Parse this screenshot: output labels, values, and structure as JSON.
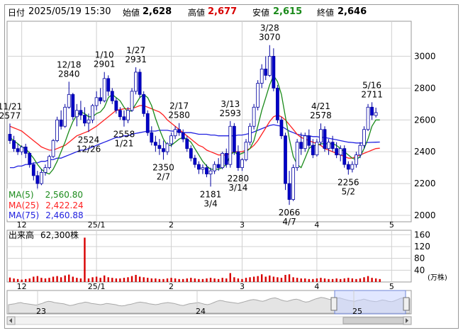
{
  "header": {
    "label_date": "日付",
    "datetime": "2025/05/19 15:30",
    "label_open": "始値",
    "open": "2,628",
    "label_high": "高値",
    "high": "2,677",
    "label_low": "安値",
    "low": "2,615",
    "label_close": "終値",
    "close": "2,646"
  },
  "colors": {
    "accent_red": "#d80000",
    "ma5": "#1a8a1a",
    "ma25": "#ff2020",
    "ma75": "#2020e0",
    "up_candle": "#ffffff",
    "down_candle": "#0000c8",
    "grid": "#d0d0d0",
    "volume": "#d80000",
    "navigator": "#a8a8a8"
  },
  "legend": {
    "ma5_label": "MA(5)",
    "ma5_value": "2,560.80",
    "ma25_label": "MA(25)",
    "ma25_value": "2,422.24",
    "ma75_label": "MA(75)",
    "ma75_value": "2,460.88"
  },
  "volume_label": "出来高",
  "volume_value": "62,300株",
  "volume_unit": "(万株)",
  "volume_ticks": [
    "160",
    "120",
    "80",
    "40"
  ],
  "nav_labels": [
    "23",
    "24",
    "25"
  ],
  "chart_data": {
    "type": "candlestick",
    "y_ticks": [
      3000,
      2800,
      2600,
      2400,
      2200,
      2000
    ],
    "ylim": [
      1960,
      3220
    ],
    "x_ticks": [
      {
        "label": "12",
        "index": 3
      },
      {
        "label": "25/1",
        "index": 22
      },
      {
        "label": "2",
        "index": 41
      },
      {
        "label": "3",
        "index": 59
      },
      {
        "label": "4",
        "index": 78
      },
      {
        "label": "5",
        "index": 97
      }
    ],
    "candles": [
      {
        "o": 2510,
        "h": 2577,
        "l": 2450,
        "c": 2470
      },
      {
        "o": 2470,
        "h": 2500,
        "l": 2400,
        "c": 2420
      },
      {
        "o": 2420,
        "h": 2450,
        "l": 2380,
        "c": 2400
      },
      {
        "o": 2400,
        "h": 2440,
        "l": 2380,
        "c": 2430
      },
      {
        "o": 2430,
        "h": 2450,
        "l": 2360,
        "c": 2390
      },
      {
        "o": 2390,
        "h": 2400,
        "l": 2300,
        "c": 2320
      },
      {
        "o": 2320,
        "h": 2330,
        "l": 2220,
        "c": 2250
      },
      {
        "o": 2250,
        "h": 2280,
        "l": 2160,
        "c": 2200
      },
      {
        "o": 2200,
        "h": 2290,
        "l": 2190,
        "c": 2270
      },
      {
        "o": 2270,
        "h": 2320,
        "l": 2250,
        "c": 2300
      },
      {
        "o": 2300,
        "h": 2380,
        "l": 2290,
        "c": 2370
      },
      {
        "o": 2370,
        "h": 2480,
        "l": 2360,
        "c": 2470
      },
      {
        "o": 2470,
        "h": 2620,
        "l": 2460,
        "c": 2600
      },
      {
        "o": 2600,
        "h": 2660,
        "l": 2540,
        "c": 2560
      },
      {
        "o": 2560,
        "h": 2700,
        "l": 2550,
        "c": 2680
      },
      {
        "o": 2680,
        "h": 2840,
        "l": 2670,
        "c": 2760
      },
      {
        "o": 2760,
        "h": 2770,
        "l": 2600,
        "c": 2620
      },
      {
        "o": 2620,
        "h": 2700,
        "l": 2560,
        "c": 2660
      },
      {
        "o": 2660,
        "h": 2720,
        "l": 2600,
        "c": 2630
      },
      {
        "o": 2630,
        "h": 2680,
        "l": 2560,
        "c": 2580
      },
      {
        "o": 2580,
        "h": 2640,
        "l": 2524,
        "c": 2600
      },
      {
        "o": 2600,
        "h": 2700,
        "l": 2580,
        "c": 2690
      },
      {
        "o": 2690,
        "h": 2780,
        "l": 2660,
        "c": 2740
      },
      {
        "o": 2740,
        "h": 2800,
        "l": 2700,
        "c": 2720
      },
      {
        "o": 2720,
        "h": 2901,
        "l": 2710,
        "c": 2860
      },
      {
        "o": 2860,
        "h": 2880,
        "l": 2750,
        "c": 2780
      },
      {
        "o": 2780,
        "h": 2800,
        "l": 2700,
        "c": 2720
      },
      {
        "o": 2720,
        "h": 2740,
        "l": 2640,
        "c": 2660
      },
      {
        "o": 2660,
        "h": 2680,
        "l": 2600,
        "c": 2620
      },
      {
        "o": 2620,
        "h": 2660,
        "l": 2558,
        "c": 2600
      },
      {
        "o": 2600,
        "h": 2680,
        "l": 2580,
        "c": 2660
      },
      {
        "o": 2660,
        "h": 2800,
        "l": 2650,
        "c": 2780
      },
      {
        "o": 2780,
        "h": 2931,
        "l": 2760,
        "c": 2900
      },
      {
        "o": 2900,
        "h": 2920,
        "l": 2740,
        "c": 2760
      },
      {
        "o": 2760,
        "h": 2780,
        "l": 2620,
        "c": 2640
      },
      {
        "o": 2640,
        "h": 2660,
        "l": 2500,
        "c": 2520
      },
      {
        "o": 2520,
        "h": 2560,
        "l": 2440,
        "c": 2460
      },
      {
        "o": 2460,
        "h": 2500,
        "l": 2400,
        "c": 2440
      },
      {
        "o": 2440,
        "h": 2480,
        "l": 2380,
        "c": 2420
      },
      {
        "o": 2420,
        "h": 2470,
        "l": 2350,
        "c": 2400
      },
      {
        "o": 2400,
        "h": 2460,
        "l": 2380,
        "c": 2450
      },
      {
        "o": 2450,
        "h": 2520,
        "l": 2430,
        "c": 2500
      },
      {
        "o": 2500,
        "h": 2560,
        "l": 2480,
        "c": 2540
      },
      {
        "o": 2540,
        "h": 2580,
        "l": 2500,
        "c": 2520
      },
      {
        "o": 2520,
        "h": 2540,
        "l": 2460,
        "c": 2480
      },
      {
        "o": 2480,
        "h": 2500,
        "l": 2400,
        "c": 2420
      },
      {
        "o": 2420,
        "h": 2440,
        "l": 2340,
        "c": 2360
      },
      {
        "o": 2360,
        "h": 2380,
        "l": 2300,
        "c": 2320
      },
      {
        "o": 2320,
        "h": 2340,
        "l": 2260,
        "c": 2290
      },
      {
        "o": 2290,
        "h": 2320,
        "l": 2260,
        "c": 2300
      },
      {
        "o": 2300,
        "h": 2320,
        "l": 2240,
        "c": 2260
      },
      {
        "o": 2260,
        "h": 2300,
        "l": 2181,
        "c": 2280
      },
      {
        "o": 2280,
        "h": 2340,
        "l": 2260,
        "c": 2320
      },
      {
        "o": 2320,
        "h": 2360,
        "l": 2280,
        "c": 2300
      },
      {
        "o": 2300,
        "h": 2400,
        "l": 2290,
        "c": 2390
      },
      {
        "o": 2390,
        "h": 2420,
        "l": 2300,
        "c": 2320
      },
      {
        "o": 2320,
        "h": 2593,
        "l": 2300,
        "c": 2560
      },
      {
        "o": 2560,
        "h": 2580,
        "l": 2380,
        "c": 2400
      },
      {
        "o": 2400,
        "h": 2440,
        "l": 2280,
        "c": 2300
      },
      {
        "o": 2300,
        "h": 2360,
        "l": 2280,
        "c": 2350
      },
      {
        "o": 2350,
        "h": 2480,
        "l": 2340,
        "c": 2460
      },
      {
        "o": 2460,
        "h": 2580,
        "l": 2440,
        "c": 2560
      },
      {
        "o": 2560,
        "h": 2700,
        "l": 2540,
        "c": 2680
      },
      {
        "o": 2680,
        "h": 2850,
        "l": 2660,
        "c": 2830
      },
      {
        "o": 2830,
        "h": 2950,
        "l": 2800,
        "c": 2920
      },
      {
        "o": 2920,
        "h": 3000,
        "l": 2850,
        "c": 2880
      },
      {
        "o": 2880,
        "h": 3070,
        "l": 2870,
        "c": 3000
      },
      {
        "o": 3000,
        "h": 3050,
        "l": 2780,
        "c": 2800
      },
      {
        "o": 2800,
        "h": 2820,
        "l": 2580,
        "c": 2600
      },
      {
        "o": 2600,
        "h": 2620,
        "l": 2480,
        "c": 2500
      },
      {
        "o": 2500,
        "h": 2520,
        "l": 2160,
        "c": 2200
      },
      {
        "o": 2200,
        "h": 2280,
        "l": 2066,
        "c": 2100
      },
      {
        "o": 2100,
        "h": 2320,
        "l": 2090,
        "c": 2300
      },
      {
        "o": 2300,
        "h": 2480,
        "l": 2280,
        "c": 2460
      },
      {
        "o": 2460,
        "h": 2520,
        "l": 2380,
        "c": 2420
      },
      {
        "o": 2420,
        "h": 2520,
        "l": 2400,
        "c": 2500
      },
      {
        "o": 2500,
        "h": 2540,
        "l": 2420,
        "c": 2440
      },
      {
        "o": 2440,
        "h": 2480,
        "l": 2360,
        "c": 2380
      },
      {
        "o": 2380,
        "h": 2480,
        "l": 2370,
        "c": 2460
      },
      {
        "o": 2460,
        "h": 2578,
        "l": 2440,
        "c": 2540
      },
      {
        "o": 2540,
        "h": 2560,
        "l": 2400,
        "c": 2420
      },
      {
        "o": 2420,
        "h": 2480,
        "l": 2380,
        "c": 2460
      },
      {
        "o": 2460,
        "h": 2500,
        "l": 2400,
        "c": 2420
      },
      {
        "o": 2420,
        "h": 2460,
        "l": 2360,
        "c": 2380
      },
      {
        "o": 2380,
        "h": 2440,
        "l": 2340,
        "c": 2420
      },
      {
        "o": 2420,
        "h": 2440,
        "l": 2300,
        "c": 2320
      },
      {
        "o": 2320,
        "h": 2340,
        "l": 2256,
        "c": 2290
      },
      {
        "o": 2290,
        "h": 2340,
        "l": 2270,
        "c": 2320
      },
      {
        "o": 2320,
        "h": 2400,
        "l": 2300,
        "c": 2380
      },
      {
        "o": 2380,
        "h": 2460,
        "l": 2360,
        "c": 2440
      },
      {
        "o": 2440,
        "h": 2560,
        "l": 2420,
        "c": 2540
      },
      {
        "o": 2540,
        "h": 2700,
        "l": 2530,
        "c": 2680
      },
      {
        "o": 2680,
        "h": 2711,
        "l": 2600,
        "c": 2630
      },
      {
        "o": 2628,
        "h": 2677,
        "l": 2615,
        "c": 2646
      }
    ],
    "ma5": [
      2490,
      2470,
      2450,
      2430,
      2420,
      2390,
      2360,
      2320,
      2290,
      2270,
      2260,
      2290,
      2340,
      2400,
      2460,
      2530,
      2590,
      2630,
      2650,
      2640,
      2620,
      2620,
      2640,
      2650,
      2680,
      2740,
      2760,
      2740,
      2720,
      2680,
      2650,
      2660,
      2700,
      2740,
      2760,
      2740,
      2690,
      2610,
      2540,
      2480,
      2440,
      2440,
      2460,
      2480,
      2490,
      2480,
      2460,
      2420,
      2380,
      2340,
      2310,
      2290,
      2290,
      2290,
      2300,
      2320,
      2380,
      2400,
      2380,
      2390,
      2400,
      2420,
      2470,
      2560,
      2660,
      2740,
      2820,
      2880,
      2840,
      2760,
      2620,
      2480,
      2370,
      2320,
      2300,
      2360,
      2420,
      2440,
      2440,
      2450,
      2450,
      2450,
      2450,
      2440,
      2420,
      2400,
      2380,
      2360,
      2350,
      2370,
      2420,
      2480,
      2560,
      2600,
      2600
    ],
    "ma25": [
      2560,
      2550,
      2540,
      2530,
      2510,
      2490,
      2470,
      2450,
      2430,
      2420,
      2410,
      2410,
      2420,
      2430,
      2440,
      2460,
      2480,
      2500,
      2510,
      2520,
      2530,
      2545,
      2560,
      2580,
      2600,
      2620,
      2640,
      2660,
      2665,
      2670,
      2670,
      2670,
      2680,
      2690,
      2690,
      2680,
      2670,
      2660,
      2650,
      2630,
      2600,
      2580,
      2560,
      2540,
      2520,
      2500,
      2480,
      2460,
      2440,
      2430,
      2410,
      2400,
      2390,
      2380,
      2380,
      2380,
      2390,
      2400,
      2400,
      2400,
      2410,
      2420,
      2440,
      2470,
      2510,
      2550,
      2590,
      2620,
      2630,
      2620,
      2600,
      2570,
      2540,
      2510,
      2490,
      2480,
      2470,
      2460,
      2450,
      2440,
      2420,
      2410,
      2400,
      2390,
      2380,
      2370,
      2360,
      2360,
      2370,
      2380,
      2390,
      2400,
      2410,
      2420,
      2422
    ],
    "ma75": [
      2300,
      2300,
      2310,
      2310,
      2320,
      2320,
      2330,
      2330,
      2340,
      2340,
      2350,
      2350,
      2360,
      2360,
      2370,
      2380,
      2390,
      2400,
      2410,
      2410,
      2420,
      2430,
      2440,
      2450,
      2460,
      2470,
      2480,
      2490,
      2490,
      2500,
      2500,
      2510,
      2515,
      2520,
      2525,
      2530,
      2530,
      2530,
      2535,
      2535,
      2535,
      2530,
      2530,
      2525,
      2520,
      2520,
      2520,
      2515,
      2510,
      2510,
      2510,
      2505,
      2505,
      2500,
      2500,
      2500,
      2500,
      2500,
      2505,
      2505,
      2510,
      2515,
      2525,
      2535,
      2545,
      2555,
      2565,
      2570,
      2565,
      2560,
      2545,
      2530,
      2520,
      2510,
      2505,
      2500,
      2500,
      2495,
      2495,
      2490,
      2490,
      2485,
      2480,
      2475,
      2470,
      2465,
      2460,
      2458,
      2455,
      2455,
      2456,
      2458,
      2459,
      2460,
      2461
    ],
    "volume": [
      15,
      12,
      10,
      8,
      10,
      12,
      18,
      20,
      14,
      12,
      14,
      18,
      20,
      16,
      22,
      25,
      18,
      14,
      12,
      14,
      12,
      16,
      18,
      14,
      22,
      16,
      14,
      12,
      12,
      14,
      16,
      20,
      24,
      18,
      16,
      14,
      12,
      12,
      10,
      10,
      12,
      14,
      12,
      10,
      10,
      12,
      14,
      12,
      10,
      10,
      12,
      14,
      12,
      10,
      14,
      12,
      30,
      16,
      12,
      10,
      14,
      16,
      18,
      20,
      26,
      18,
      22,
      18,
      16,
      14,
      24,
      26,
      16,
      14,
      12,
      12,
      10,
      10,
      12,
      14,
      12,
      10,
      10,
      12,
      10,
      12,
      14,
      12,
      10,
      12,
      16,
      20,
      14,
      12,
      10
    ],
    "volume_spikes": [
      {
        "index": 19,
        "value": 150
      }
    ],
    "volume_ylim": [
      0,
      175
    ],
    "annotations": [
      {
        "label": "11/21",
        "value": "2577",
        "index": 0,
        "pos": "above"
      },
      {
        "label": "12/18",
        "value": "2840",
        "index": 15,
        "pos": "above"
      },
      {
        "label": "1/10",
        "value": "2901",
        "index": 24,
        "pos": "above"
      },
      {
        "label": "1/27",
        "value": "2931",
        "index": 32,
        "pos": "above"
      },
      {
        "label": "2/17",
        "value": "2580",
        "index": 43,
        "pos": "above"
      },
      {
        "label": "3/13",
        "value": "2593",
        "index": 56,
        "pos": "above"
      },
      {
        "label": "3/28",
        "value": "3070",
        "index": 66,
        "pos": "above"
      },
      {
        "label": "4/21",
        "value": "2578",
        "index": 79,
        "pos": "above"
      },
      {
        "label": "5/16",
        "value": "2711",
        "index": 92,
        "pos": "above"
      },
      {
        "value": "2524",
        "label": "12/26",
        "index": 20,
        "pos": "below"
      },
      {
        "value": "2558",
        "label": "1/21",
        "index": 29,
        "pos": "below"
      },
      {
        "value": "2350",
        "label": "2/7",
        "index": 39,
        "pos": "below"
      },
      {
        "value": "2181",
        "label": "3/4",
        "index": 51,
        "pos": "below"
      },
      {
        "value": "2280",
        "label": "3/14",
        "index": 58,
        "pos": "below"
      },
      {
        "value": "2066",
        "label": "4/7",
        "index": 71,
        "pos": "below"
      },
      {
        "value": "2256",
        "label": "5/2",
        "index": 86,
        "pos": "below"
      }
    ],
    "navigator": [
      0.4,
      0.42,
      0.44,
      0.48,
      0.5,
      0.46,
      0.44,
      0.42,
      0.4,
      0.38,
      0.42,
      0.46,
      0.52,
      0.56,
      0.54,
      0.5,
      0.48,
      0.46,
      0.44,
      0.4,
      0.36,
      0.38,
      0.42,
      0.46,
      0.48,
      0.52,
      0.5,
      0.46,
      0.44,
      0.42,
      0.4,
      0.42,
      0.46,
      0.44,
      0.42,
      0.4,
      0.36,
      0.34,
      0.36,
      0.4,
      0.42,
      0.46,
      0.5,
      0.52,
      0.5,
      0.48,
      0.44,
      0.42,
      0.4,
      0.42,
      0.46,
      0.48,
      0.5,
      0.48,
      0.46,
      0.42,
      0.38,
      0.36,
      0.4,
      0.44,
      0.46,
      0.48,
      0.5,
      0.46,
      0.42,
      0.4,
      0.44,
      0.5,
      0.56,
      0.6,
      0.58,
      0.54,
      0.52,
      0.5,
      0.48,
      0.46,
      0.5,
      0.54,
      0.58,
      0.62,
      0.64,
      0.62,
      0.58,
      0.56,
      0.6,
      0.66,
      0.7,
      0.72,
      0.68,
      0.62,
      0.58,
      0.56,
      0.6,
      0.64,
      0.66,
      0.62,
      0.56,
      0.52,
      0.54,
      0.6,
      0.66,
      0.7,
      0.74,
      0.72,
      0.68,
      0.64,
      0.66,
      0.7,
      0.72,
      0.68,
      0.64,
      0.6,
      0.58,
      0.56,
      0.6,
      0.62,
      0.66,
      0.62,
      0.58,
      0.56,
      0.54,
      0.58,
      0.62,
      0.6,
      0.56,
      0.54,
      0.58,
      0.64,
      0.7,
      0.72,
      0.7,
      0.68
    ]
  }
}
